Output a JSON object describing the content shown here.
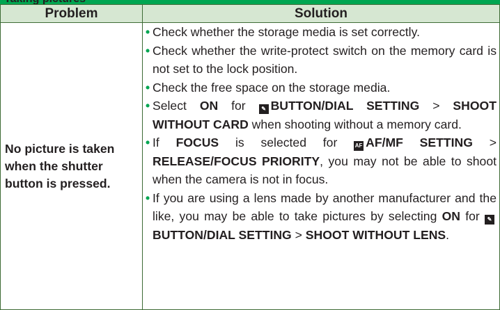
{
  "section": {
    "title": "Taking pictures"
  },
  "table": {
    "headers": {
      "problem": "Problem",
      "solution": "Solution"
    },
    "problem_lines": [
      "No picture is taken",
      "when the shutter",
      "button is pressed."
    ]
  },
  "solutions": [
    {
      "parts": [
        {
          "t": "Check whether the storage media is set correctly."
        }
      ]
    },
    {
      "parts": [
        {
          "t": "Check whether the write-protect switch on the memory card is not set to the lock position."
        }
      ]
    },
    {
      "parts": [
        {
          "t": "Check the free space on the storage media."
        }
      ]
    },
    {
      "parts": [
        {
          "t": "Select "
        },
        {
          "t": "ON",
          "b": true
        },
        {
          "t": " for "
        },
        {
          "icon": "button-dial-setting-icon"
        },
        {
          "t": "BUTTON/DIAL SETTING",
          "b": true
        },
        {
          "t": " > "
        },
        {
          "t": "SHOOT WITHOUT CARD",
          "b": true
        },
        {
          "t": " when shooting without a memory card."
        }
      ]
    },
    {
      "parts": [
        {
          "t": "If "
        },
        {
          "t": "FOCUS",
          "b": true
        },
        {
          "t": " is selected for "
        },
        {
          "icon": "af-mf-setting-icon"
        },
        {
          "t": "AF/MF SETTING",
          "b": true
        },
        {
          "t": " > "
        },
        {
          "t": "RELEASE/FOCUS PRIORITY",
          "b": true
        },
        {
          "t": ", you may not be able to shoot when the camera is not in focus."
        }
      ]
    },
    {
      "parts": [
        {
          "t": "If you are using a lens made by another manufacturer and the like, you may be able to take pictures by selecting "
        },
        {
          "t": "ON",
          "b": true
        },
        {
          "t": " for "
        },
        {
          "icon": "button-dial-setting-icon"
        },
        {
          "t": "BUTTON/DIAL SETTING",
          "b": true
        },
        {
          "t": " > "
        },
        {
          "t": "SHOOT WITHOUT LENS",
          "b": true
        },
        {
          "t": "."
        }
      ]
    }
  ]
}
